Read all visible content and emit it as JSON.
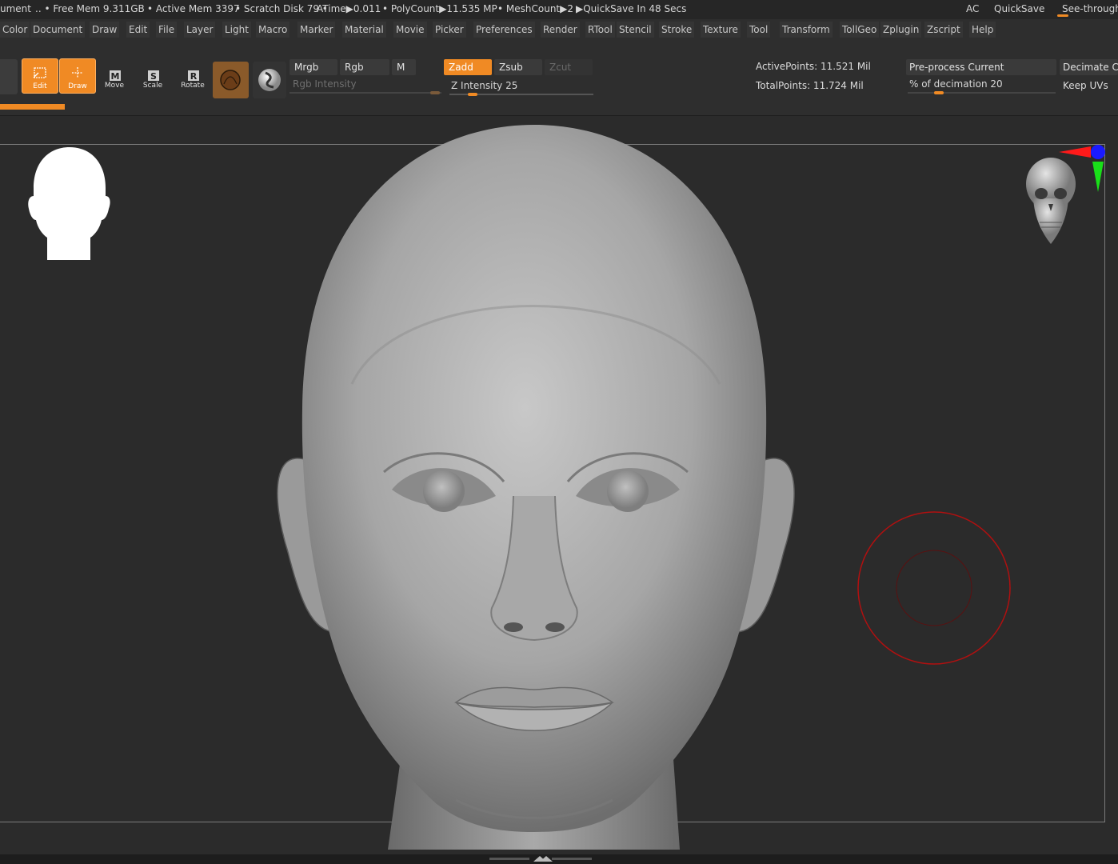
{
  "status": {
    "doc_fragment": "ument",
    "free_mem": ".. • Free Mem 9.311GB",
    "active_mem": "• Active Mem 3397",
    "scratch_disk": "• Scratch Disk 79 •",
    "atime": "ATime▶0.011",
    "polycount": "• PolyCount▶11.535 MP",
    "meshcount": "• MeshCount▶2",
    "quicksave_timer": "▶QuickSave In 48 Secs",
    "ac": "AC",
    "quicksave": "QuickSave",
    "see_through": "See-through"
  },
  "menu": [
    "Color",
    "Document",
    "Draw",
    "Edit",
    "File",
    "Layer",
    "Light",
    "Macro",
    "Marker",
    "Material",
    "Movie",
    "Picker",
    "Preferences",
    "Render",
    "RTool",
    "Stencil",
    "Stroke",
    "Texture",
    "Tool",
    "Transform",
    "TollGeo",
    "Zplugin",
    "Zscript",
    "Help"
  ],
  "toolbar": {
    "edit": "Edit",
    "draw": "Draw",
    "move": "Move",
    "scale": "Scale",
    "rotate": "Rotate",
    "mrgb": "Mrgb",
    "rgb": "Rgb",
    "m": "M",
    "rgb_intensity": "Rgb Intensity",
    "zadd": "Zadd",
    "zsub": "Zsub",
    "zcut": "Zcut",
    "z_intensity_label": "Z Intensity",
    "z_intensity_value": "25",
    "z_intensity_level": 0.25,
    "active_points": "ActivePoints: 11.521 Mil",
    "total_points": "TotalPoints: 11.724 Mil",
    "preprocess": "Pre-process Current",
    "decimation_label": "% of decimation",
    "decimation_value": "20",
    "decimate": "Decimate Cu",
    "keep_uvs": "Keep UVs"
  },
  "icon_letters": {
    "move": "M",
    "scale": "S",
    "rotate": "R"
  },
  "colors": {
    "accent": "#f08a24",
    "axis_x": "#ff1a1a",
    "axis_y": "#19e019",
    "axis_z": "#1a1aff",
    "brush": "#b01010"
  }
}
